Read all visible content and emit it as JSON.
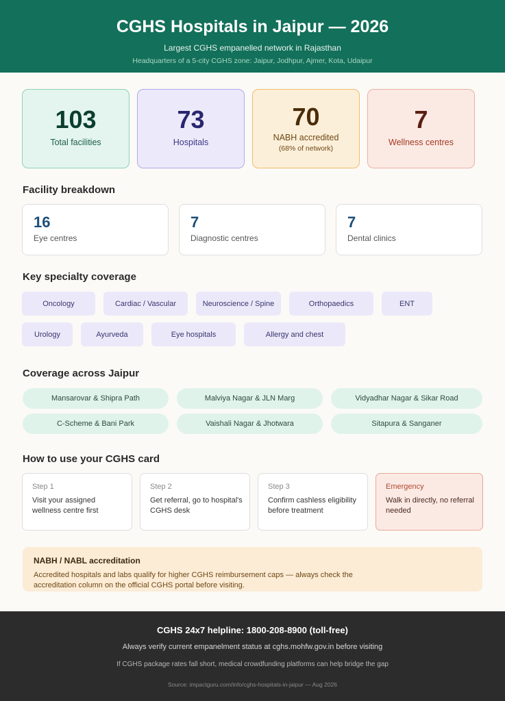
{
  "header": {
    "title": "CGHS Hospitals in Jaipur — 2026",
    "subtitle": "Largest CGHS empanelled network in Rajasthan",
    "tagline": "Headquarters of a 5-city CGHS zone: Jaipur, Jodhpur, Ajmer, Kota, Udaipur"
  },
  "stats": [
    {
      "value": "103",
      "label": "Total facilities"
    },
    {
      "value": "73",
      "label": "Hospitals"
    },
    {
      "value": "70",
      "label": "NABH accredited",
      "note": "(68% of network)"
    },
    {
      "value": "7",
      "label": "Wellness centres"
    }
  ],
  "facility": {
    "title": "Facility breakdown",
    "items": [
      {
        "value": "16",
        "label": "Eye centres"
      },
      {
        "value": "7",
        "label": "Diagnostic centres"
      },
      {
        "value": "7",
        "label": "Dental clinics"
      }
    ]
  },
  "specialty": {
    "title": "Key specialty coverage",
    "items": [
      "Oncology",
      "Cardiac / Vascular",
      "Neuroscience / Spine",
      "Orthopaedics",
      "ENT",
      "Urology",
      "Ayurveda",
      "Eye hospitals",
      "Allergy and chest"
    ]
  },
  "coverage": {
    "title": "Coverage across Jaipur",
    "areas": [
      "Mansarovar & Shipra Path",
      "Malviya Nagar & JLN Marg",
      "Vidyadhar Nagar & Sikar Road",
      "C-Scheme & Bani Park",
      "Vaishali Nagar & Jhotwara",
      "Sitapura & Sanganer"
    ]
  },
  "howto": {
    "title": "How to use your CGHS card",
    "steps": [
      {
        "label": "Step 1",
        "text": "Visit your assigned wellness centre first"
      },
      {
        "label": "Step 2",
        "text": "Get referral, go to hospital's CGHS desk"
      },
      {
        "label": "Step 3",
        "text": "Confirm cashless eligibility before treatment"
      },
      {
        "label": "Emergency",
        "text": "Walk in directly, no referral needed"
      }
    ]
  },
  "nabh": {
    "title": "NABH / NABL accreditation",
    "body": "Accredited hospitals and labs qualify for higher CGHS reimbursement caps — always check the accreditation column on the official CGHS portal before visiting."
  },
  "footer": {
    "helpline": "CGHS 24x7 helpline: 1800-208-8900 (toll-free)",
    "verify": "Always verify current empanelment status at cghs.mohfw.gov.in before visiting",
    "crowdfunding": "If CGHS package rates fall short, medical crowdfunding platforms can help bridge the gap",
    "source": "Source: impactguru.com/info/cghs-hospitals-in-jaipur — Aug 2026"
  },
  "colors": {
    "header": "#13705a",
    "footer": "#2c2c2c",
    "chip": "#ebe9f9",
    "area": "#e0f3eb",
    "notice": "#fcecd6"
  }
}
